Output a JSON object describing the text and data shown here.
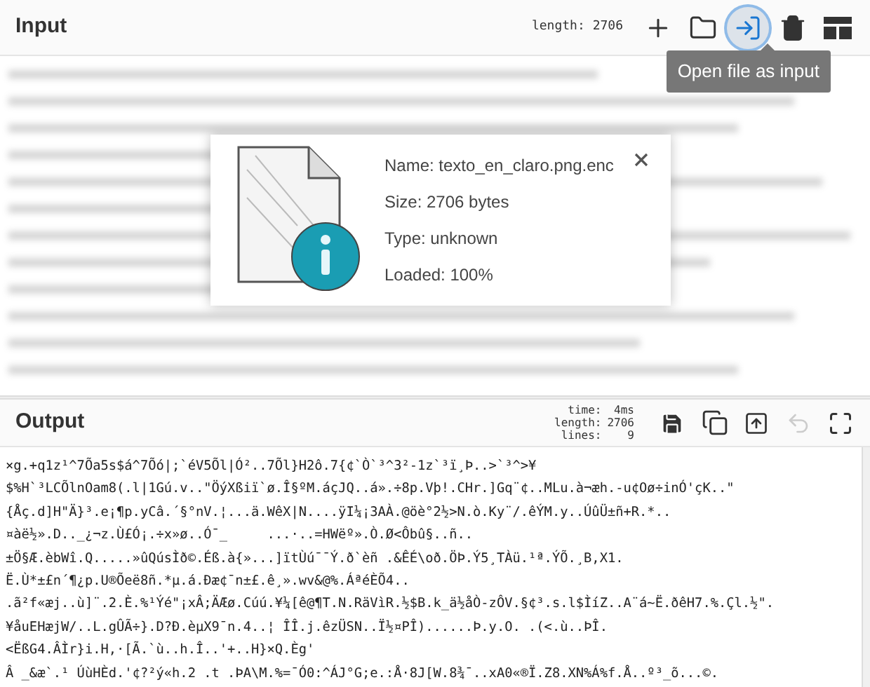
{
  "input": {
    "title": "Input",
    "length": "length: 2706",
    "buttons": [
      {
        "kind": "add",
        "selected": false
      },
      {
        "kind": "open-folder",
        "selected": false
      },
      {
        "kind": "open-file",
        "selected": true
      },
      {
        "kind": "clear",
        "selected": false
      },
      {
        "kind": "layout",
        "selected": false
      }
    ],
    "tooltip": "Open file as input"
  },
  "file_info": {
    "lines": [
      "Name: texto_en_claro.png.enc",
      "Size: 2706 bytes",
      "Type: unknown",
      "Loaded: 100%"
    ]
  },
  "output": {
    "title": "Output",
    "stats": [
      {
        "label": "time:",
        "value": "4ms"
      },
      {
        "label": "length:",
        "value": "2706"
      },
      {
        "label": "lines:",
        "value": "9"
      }
    ],
    "buttons": [
      {
        "kind": "save",
        "disabled": false
      },
      {
        "kind": "copy",
        "disabled": false
      },
      {
        "kind": "replace-input",
        "disabled": false
      },
      {
        "kind": "undo",
        "disabled": true
      },
      {
        "kind": "maximize",
        "disabled": false
      }
    ],
    "lines": [
      "×g.+q1z¹^7Õa5s$á^7Õó|;`éV5Õl|Ó²..7Õl}H2ô.7{¢`Ò`³^3²-1z`³ï¸Þ..>`³^>¥",
      "$%H`³LCÕlnOam8(.l|1Gú.v..\"ÖýXßiï`ø.Î§ºM.áçJQ..á».÷8p.Vþ!.CHr.]Gq¨¢..MLu.à¬æh.-u¢Oø÷inÓ'çK..\"",
      "{Åç.d]H\"Ä}³.e¡¶p.yCâ.´§°nV.¦...ä.WêX|N....ÿI¼¡3AÀ.@öè°2½>N.ò.Ky¨/.êÝM.y..ÚûÜ±ñ+R.*..",
      "¤àë½».D.._¿¬z.Ù£Ó¡.÷x»ø..Ó¯_     ...·..=HWëº».Ò.Ø<Ôbû§..ñ..",
      "±Ö§Æ.èbWî.Q.....»ûQúsÌð©.Éß.à{»...]ïtÙú¯¯Ý.ð`èñ .&ÊÉ\\oð.ÖÞ.Ý5¸TÀü.¹ª.ÝÕ.¸B,X1.",
      "Ë.Ù*±£n´¶¿p.U®Õeë8ñ.*µ.á.Ðæ¢¯n±£.ê¸».wv&@%.ÁªéÈÕ4..",
      ".ã²f«æj..ù]¨.2.È.%¹Ýé\"¡xÂ;ÄÆø.Cúú.¥¼[ê@¶T.N.RäVìR.½$B.k_ä½åÒ-zÔV.§¢³.s.l$ÌíZ..A¨á~Ë.ðêH7.%.Çl.½\".",
      "¥åuEHæjW/..L.gÛÃ÷}.D?Ð.èµX9¯n.4..¦ ÎÎ.j.êzÜSN..Ï½¤PÎ)......Þ.y.O. .(<.ù..ÞÎ.",
      "<ËßG4.ÂÌr}i.H,·[Ã.`ù..h.Î..'+..H}×Q.Èg'",
      "Â _&æ`.¹ ÚùHÈd.'¢?²ý«h.2 .t .ÞA\\M.%=¯Ó0:^ÁJ°G;e.:Å·8J[W.8¾¯..xA0«®Ï.Z8.XN%Á%f.Å..º³_õ...©."
    ]
  }
}
